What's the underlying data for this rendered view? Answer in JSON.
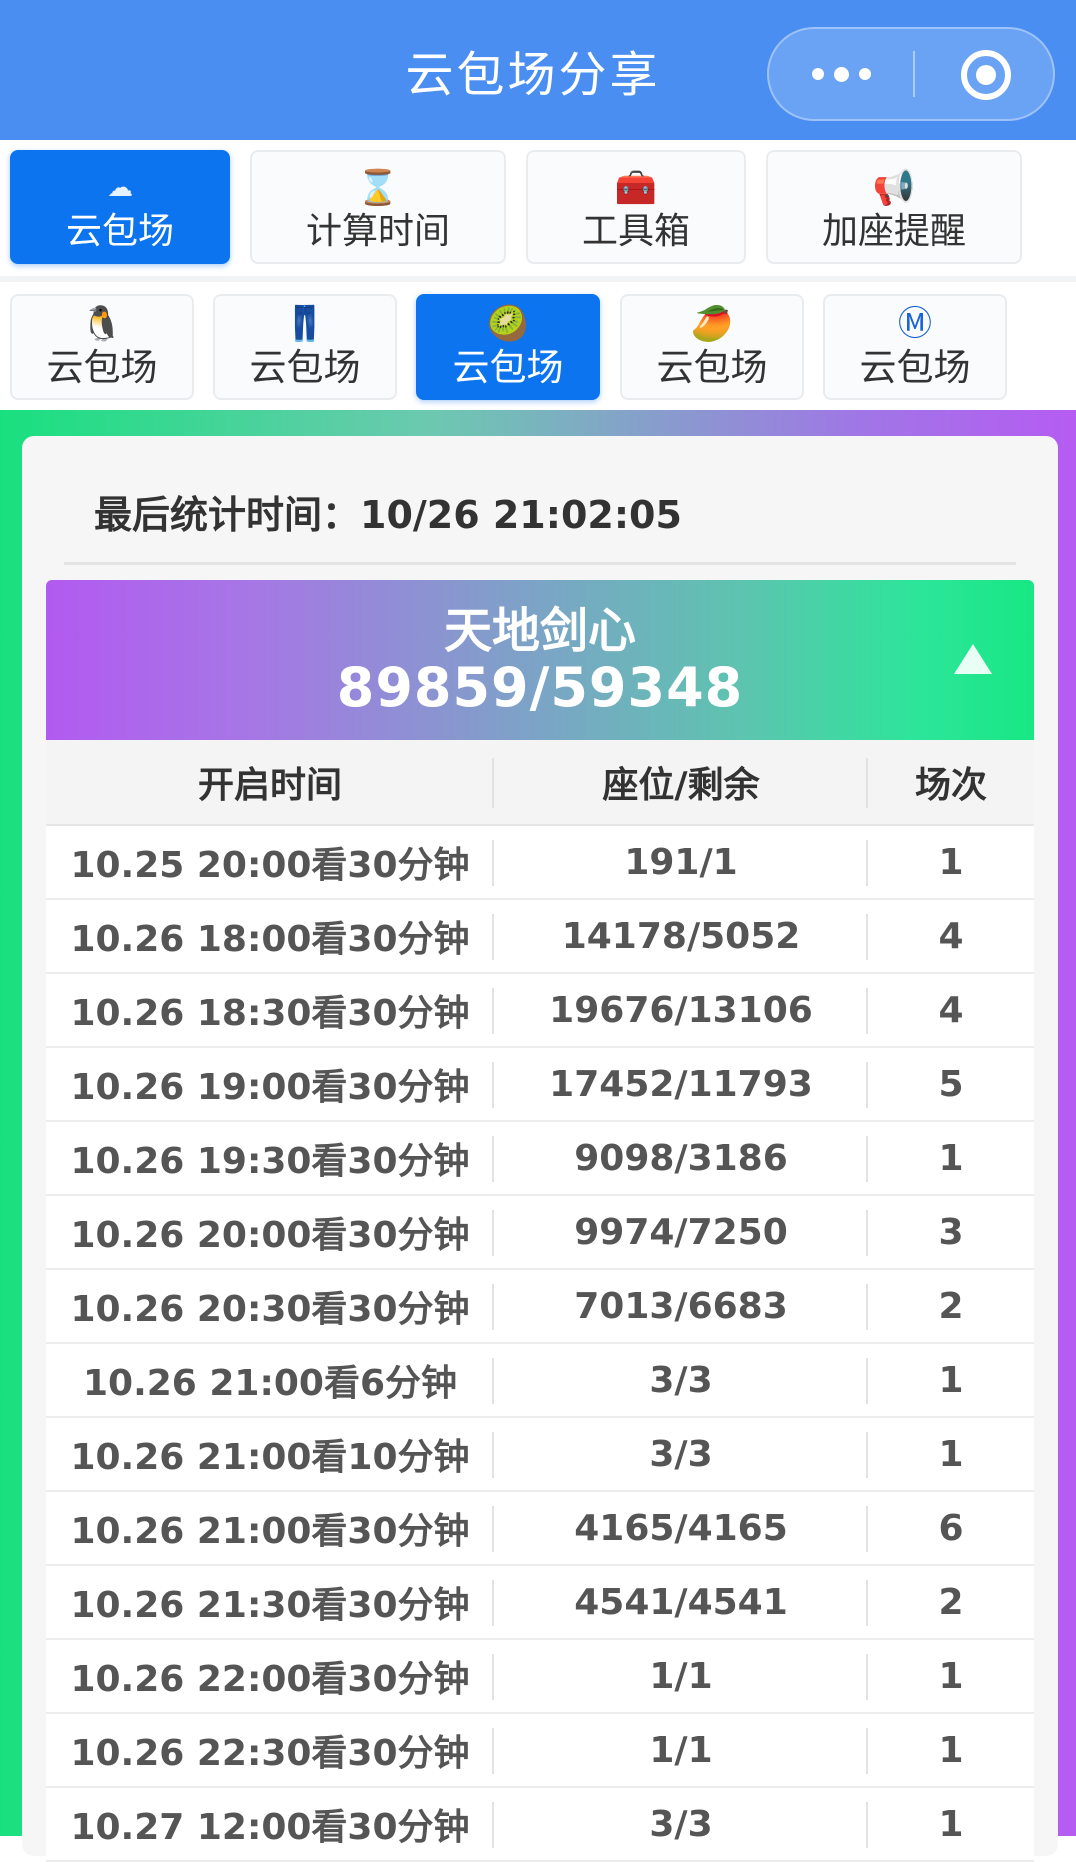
{
  "nav": {
    "title": "云包场分享",
    "more_icon": "more-dots-icon",
    "close_icon": "target-circle-icon"
  },
  "function_tabs": [
    {
      "label": "云包场",
      "icon": "cloud-icon",
      "glyph": "☁",
      "active": true
    },
    {
      "label": "计算时间",
      "icon": "hourglass-icon",
      "glyph": "⌛",
      "active": false
    },
    {
      "label": "工具箱",
      "icon": "toolbox-icon",
      "glyph": "🧰",
      "active": false
    },
    {
      "label": "加座提醒",
      "icon": "megaphone-icon",
      "glyph": "📢",
      "active": false
    }
  ],
  "platform_tabs": [
    {
      "label": "云包场",
      "icon": "penguin-icon",
      "glyph": "🐧",
      "active": false
    },
    {
      "label": "云包场",
      "icon": "jeans-icon",
      "glyph": "👖",
      "active": false
    },
    {
      "label": "云包场",
      "icon": "kiwi-icon",
      "glyph": "🥝",
      "active": true
    },
    {
      "label": "云包场",
      "icon": "mango-icon",
      "glyph": "🥭",
      "active": false
    },
    {
      "label": "云包场",
      "icon": "metro-m-icon",
      "glyph": "Ⓜ",
      "active": false
    }
  ],
  "stats": {
    "last_update": "最后统计时间：10/26 21:02:05"
  },
  "movie": {
    "title": "天地剑心",
    "count": "89859/59348",
    "collapse_icon": "triangle-up-icon"
  },
  "table": {
    "headers": [
      "开启时间",
      "座位/剩余",
      "场次"
    ],
    "rows": [
      [
        "10.25 20:00看30分钟",
        "191/1",
        "1"
      ],
      [
        "10.26 18:00看30分钟",
        "14178/5052",
        "4"
      ],
      [
        "10.26 18:30看30分钟",
        "19676/13106",
        "4"
      ],
      [
        "10.26 19:00看30分钟",
        "17452/11793",
        "5"
      ],
      [
        "10.26 19:30看30分钟",
        "9098/3186",
        "1"
      ],
      [
        "10.26 20:00看30分钟",
        "9974/7250",
        "3"
      ],
      [
        "10.26 20:30看30分钟",
        "7013/6683",
        "2"
      ],
      [
        "10.26 21:00看6分钟",
        "3/3",
        "1"
      ],
      [
        "10.26 21:00看10分钟",
        "3/3",
        "1"
      ],
      [
        "10.26 21:00看30分钟",
        "4165/4165",
        "6"
      ],
      [
        "10.26 21:30看30分钟",
        "4541/4541",
        "2"
      ],
      [
        "10.26 22:00看30分钟",
        "1/1",
        "1"
      ],
      [
        "10.26 22:30看30分钟",
        "1/1",
        "1"
      ],
      [
        "10.27 12:00看30分钟",
        "3/3",
        "1"
      ]
    ]
  },
  "colors": {
    "nav_blue": "#4a8ef2",
    "active_tab": "#0d74ef",
    "gradient_green": "#19e07f",
    "gradient_purple": "#b65cf2"
  }
}
